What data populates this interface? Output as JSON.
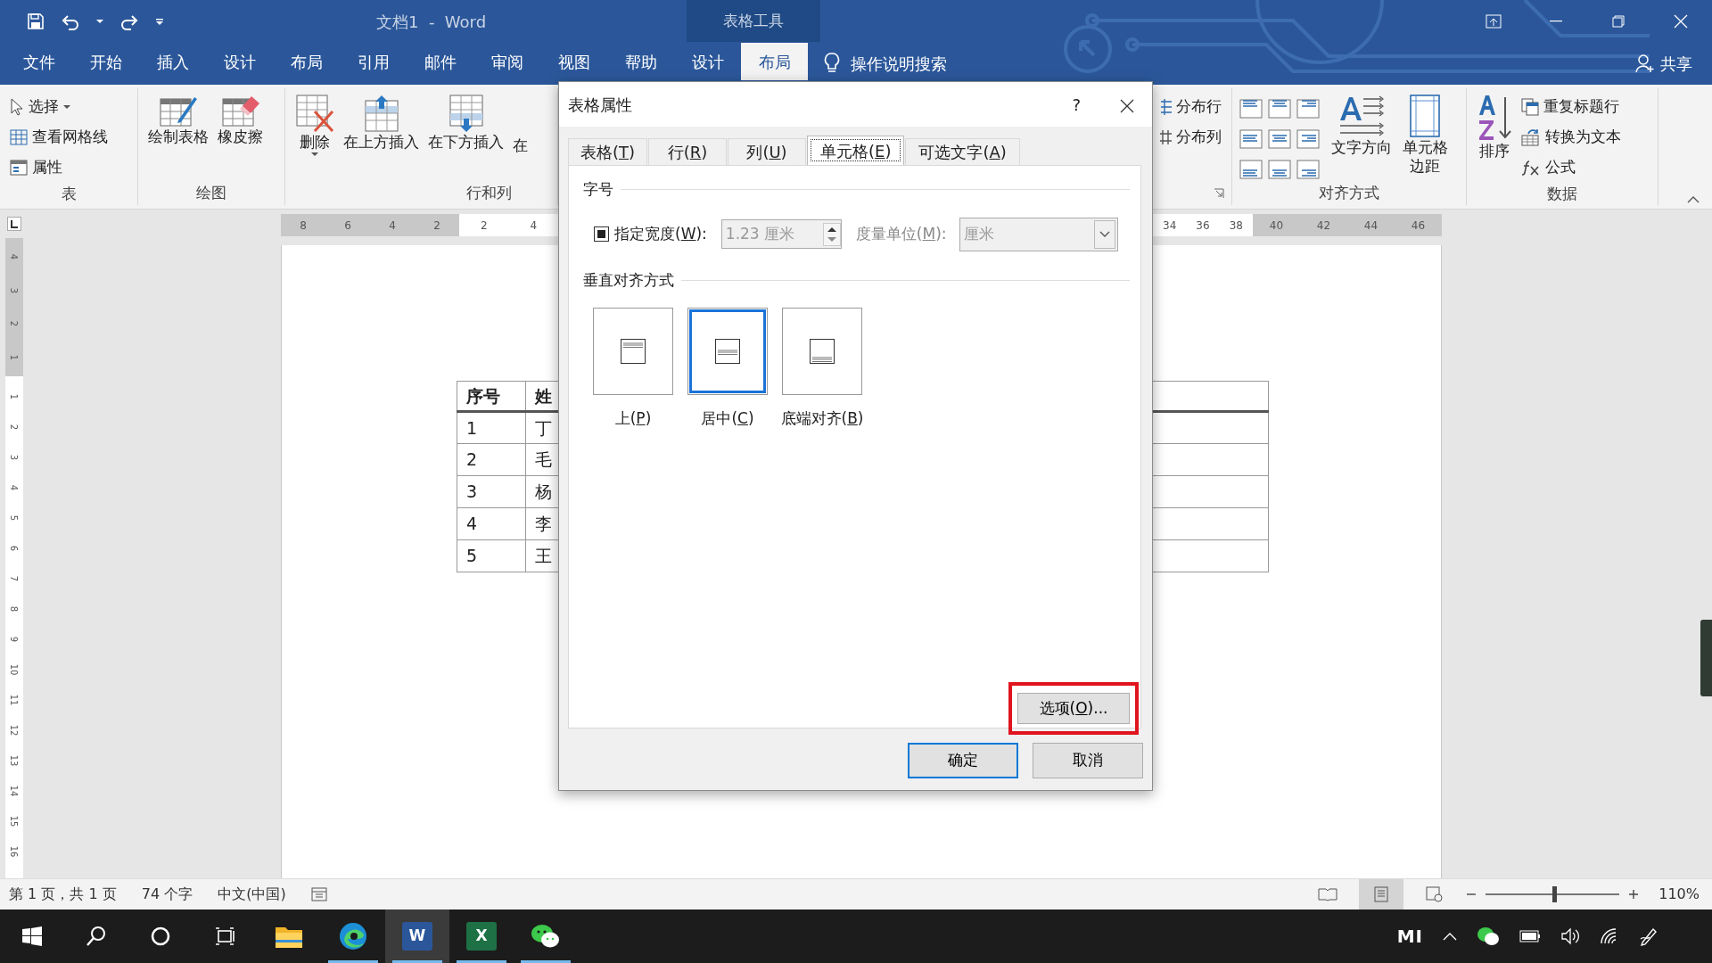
{
  "title_bar": {
    "title": "文档1  -  Word",
    "context_tab": "表格工具"
  },
  "menu_tabs": [
    {
      "label": "文件",
      "selected": false
    },
    {
      "label": "开始",
      "selected": false
    },
    {
      "label": "插入",
      "selected": false
    },
    {
      "label": "设计",
      "selected": false
    },
    {
      "label": "布局",
      "selected": false
    },
    {
      "label": "引用",
      "selected": false
    },
    {
      "label": "邮件",
      "selected": false
    },
    {
      "label": "审阅",
      "selected": false
    },
    {
      "label": "视图",
      "selected": false
    },
    {
      "label": "帮助",
      "selected": false
    },
    {
      "label": "设计",
      "selected": false
    },
    {
      "label": "布局",
      "selected": true
    }
  ],
  "tell_me": "操作说明搜索",
  "share": "共享",
  "ribbon_groups": [
    {
      "label": "表",
      "items": [
        {
          "kind": "small",
          "label": "选择",
          "caret": true
        },
        {
          "kind": "small",
          "label": "查看网格线",
          "caret": false
        },
        {
          "kind": "small",
          "label": "属性",
          "caret": false
        }
      ]
    },
    {
      "label": "绘图",
      "items": [
        {
          "kind": "large",
          "label": "绘制表格",
          "caret": false
        },
        {
          "kind": "large",
          "label": "橡皮擦",
          "caret": false
        }
      ]
    },
    {
      "label": "行和列",
      "items": [
        {
          "kind": "large",
          "label": "删除",
          "caret": true
        },
        {
          "kind": "large",
          "label": "在上方插入",
          "caret": false
        },
        {
          "kind": "large",
          "label": "在下方插入",
          "caret": false
        },
        {
          "kind": "large",
          "label": "在",
          "caret": false
        }
      ]
    },
    {
      "items": [
        {
          "kind": "small",
          "label": "分布行",
          "caret": false
        },
        {
          "kind": "small",
          "label": "分布列",
          "caret": false
        }
      ]
    },
    {
      "label": "对齐方式",
      "items": [
        {
          "kind": "grid"
        },
        {
          "kind": "large",
          "label": "文字方向",
          "caret": false
        },
        {
          "kind": "large",
          "label": "单元格边距",
          "caret": false
        }
      ]
    },
    {
      "label": "数据",
      "items": [
        {
          "kind": "large",
          "label": "排序",
          "caret": false
        },
        {
          "kind": "stack",
          "children": [
            {
              "kind": "small",
              "label": "重复标题行",
              "caret": false
            },
            {
              "kind": "small",
              "label": "转换为文本",
              "caret": false
            },
            {
              "kind": "small",
              "label": "公式",
              "caret": false
            }
          ]
        }
      ]
    }
  ],
  "ruler": {
    "horizontal": [
      {
        "margin": true,
        "labels": [
          "8",
          "6",
          "4",
          "2"
        ]
      },
      {
        "margin": false,
        "labels": [
          "2",
          "4"
        ]
      },
      {
        "margin": false,
        "labels": [
          "34",
          "36",
          "38"
        ]
      },
      {
        "margin": true,
        "labels": [
          "40",
          "42",
          "44",
          "46"
        ]
      }
    ],
    "vertical": [
      "4",
      "3",
      "2",
      "1",
      "1",
      "2",
      "3",
      "4",
      "5",
      "6",
      "7",
      "8",
      "9",
      "10",
      "11",
      "12",
      "13",
      "14",
      "15",
      "16"
    ]
  },
  "table": {
    "rows": [
      [
        "序号",
        "姓"
      ],
      [
        "1",
        "丁"
      ],
      [
        "2",
        "毛"
      ],
      [
        "3",
        "杨"
      ],
      [
        "4",
        "李"
      ],
      [
        "5",
        "王"
      ]
    ]
  },
  "dialog": {
    "title": "表格属性",
    "help": "?",
    "tabs": [
      {
        "label": "表格(T)",
        "selected": false
      },
      {
        "label": "行(R)",
        "selected": false
      },
      {
        "label": "列(U)",
        "selected": false
      },
      {
        "label": "单元格(E)",
        "selected": true
      },
      {
        "label": "可选文字(A)",
        "selected": false
      }
    ],
    "size_section": "字号",
    "width_checkbox": {
      "label": "指定宽度(W):",
      "checked": true
    },
    "width_field": {
      "value": "1.23 厘米",
      "disabled": true
    },
    "unit_label": "度量单位(M):",
    "unit_dropdown": {
      "value": "厘米",
      "disabled": true
    },
    "valign_section": "垂直对齐方式",
    "valign_options": [
      {
        "label": "上(P)",
        "selected": false
      },
      {
        "label": "居中(C)",
        "selected": true
      },
      {
        "label": "底端对齐(B)",
        "selected": false
      }
    ],
    "options_button": {
      "label": "选项(O)...",
      "highlighted": true
    },
    "buttons": [
      {
        "label": "确定",
        "default": true
      },
      {
        "label": "取消",
        "default": false
      }
    ]
  },
  "status_bar": {
    "items": [
      "第 1 页，共 1 页",
      "74 个字",
      "中文(中国)"
    ],
    "views": [
      {
        "selected": false
      },
      {
        "selected": true
      },
      {
        "selected": false
      }
    ],
    "zoom": {
      "level": 0.51,
      "reading": "110%"
    }
  },
  "taskbar": {
    "apps": [
      {
        "running": false,
        "active": false
      },
      {
        "running": true,
        "active": false
      },
      {
        "glyph": "W",
        "running": true,
        "active": true
      },
      {
        "glyph": "X",
        "running": true,
        "active": false
      },
      {
        "running": true,
        "active": false
      }
    ],
    "brand": "MI"
  }
}
